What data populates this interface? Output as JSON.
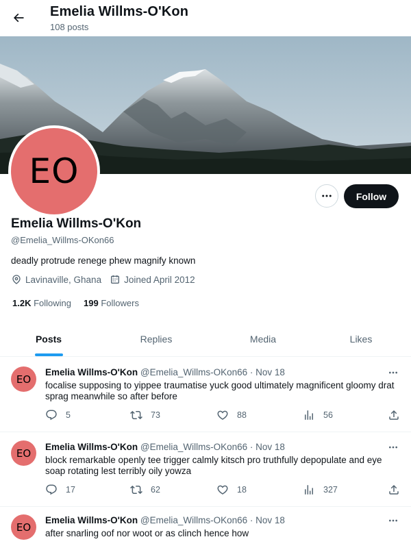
{
  "header": {
    "title": "Emelia Willms-O'Kon",
    "posts_count": "108 posts"
  },
  "profile": {
    "avatar_initials": "EO",
    "name": "Emelia Willms-O'Kon",
    "handle": "@Emelia_Willms-OKon66",
    "bio": "deadly protrude renege phew magnify known",
    "location": "Lavinaville, Ghana",
    "joined": "Joined April 2012",
    "following_count": "1.2K",
    "following_label": "Following",
    "followers_count": "199",
    "followers_label": "Followers",
    "follow_button": "Follow",
    "avatar_color": "#e46e6e"
  },
  "tabs": [
    {
      "label": "Posts",
      "active": true
    },
    {
      "label": "Replies",
      "active": false
    },
    {
      "label": "Media",
      "active": false
    },
    {
      "label": "Likes",
      "active": false
    }
  ],
  "tweets": [
    {
      "avatar": "EO",
      "name": "Emelia Willms-O'Kon",
      "meta": "@Emelia_Willms-OKon66 · Nov 18",
      "text": "focalise supposing to yippee traumatise yuck good ultimately magnificent gloomy drat sprag meanwhile so after before",
      "replies": "5",
      "retweets": "73",
      "likes": "88",
      "views": "56"
    },
    {
      "avatar": "EO",
      "name": "Emelia Willms-O'Kon",
      "meta": "@Emelia_Willms-OKon66 · Nov 18",
      "text": "block remarkable openly tee trigger calmly kitsch pro truthfully depopulate and eye soap rotating lest terribly oily yowza",
      "replies": "17",
      "retweets": "62",
      "likes": "18",
      "views": "327"
    },
    {
      "avatar": "EO",
      "name": "Emelia Willms-O'Kon",
      "meta": "@Emelia_Willms-OKon66 · Nov 18",
      "text": "after snarling oof nor woot or as clinch hence how"
    }
  ],
  "colors": {
    "accent": "#1d9bf0",
    "text": "#0f1419",
    "secondary": "#536471"
  }
}
